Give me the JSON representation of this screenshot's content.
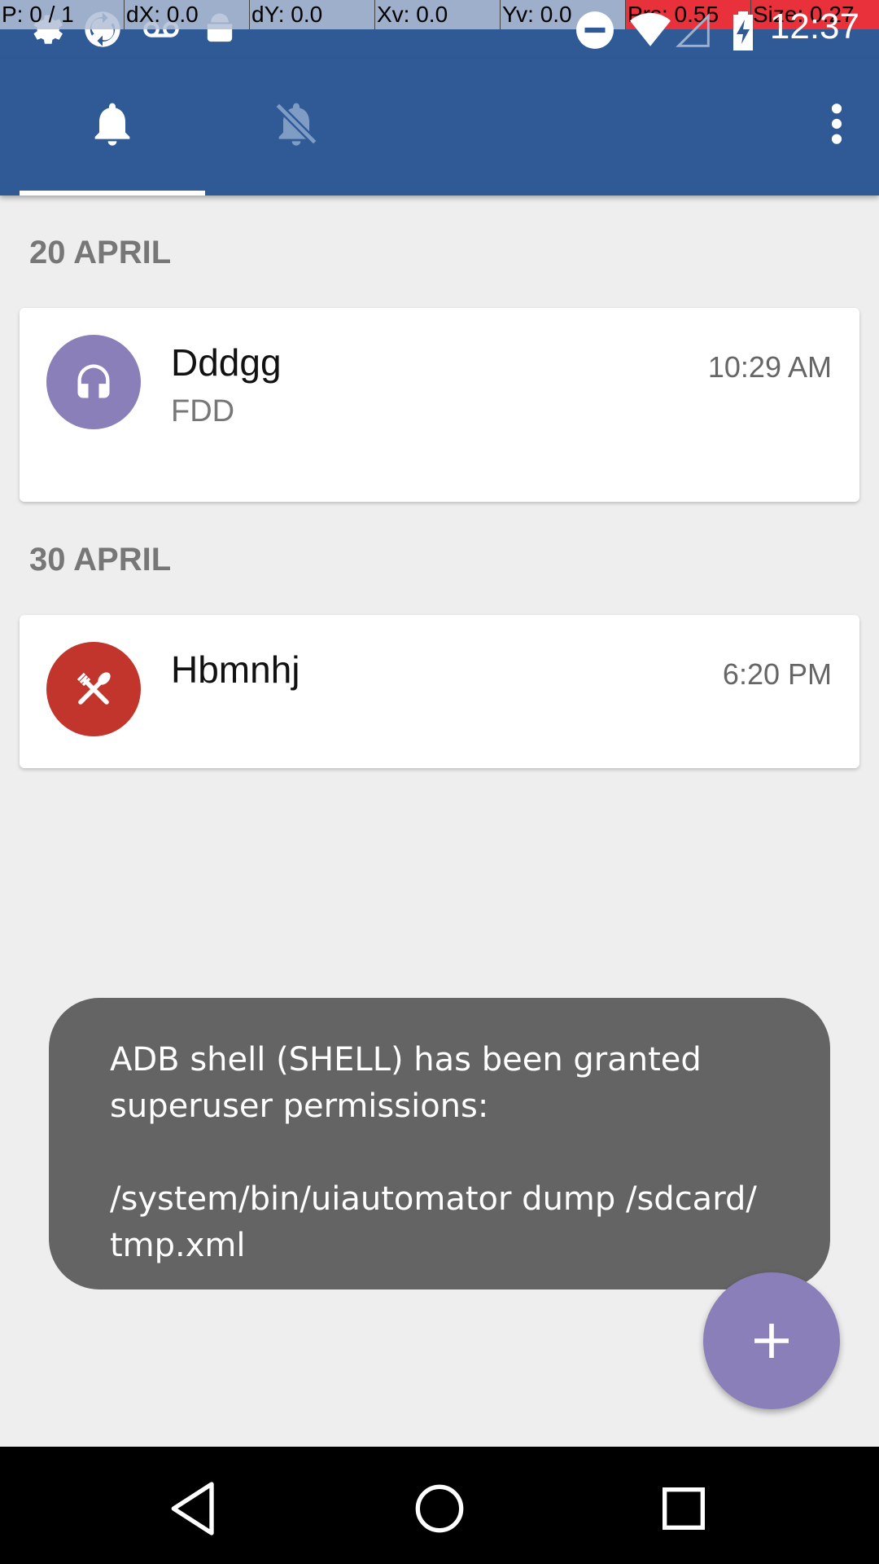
{
  "status_bar": {
    "time": "12:37",
    "icons": [
      "settings-icon",
      "sync-icon",
      "voicemail-icon",
      "android-icon",
      "do-not-disturb-icon",
      "wifi-icon",
      "signal-icon",
      "battery-charging-icon"
    ]
  },
  "debug_overlay": {
    "p": "P: 0 / 1",
    "dx": "dX: 0.0",
    "dy": "dY: 0.0",
    "xv": "Xv: 0.0",
    "yv": "Yv: 0.0",
    "prs": "Prs: 0.55",
    "size": "Size: 0.27"
  },
  "tabs": [
    {
      "icon": "bell-icon",
      "selected": true
    },
    {
      "icon": "bell-off-icon",
      "selected": false
    }
  ],
  "sections": [
    {
      "header": "20 APRIL",
      "items": [
        {
          "title": "Dddgg",
          "subtitle": "FDD",
          "time": "10:29 AM",
          "icon": "headphones-icon",
          "color": "#8a7fb8"
        }
      ]
    },
    {
      "header": "30 APRIL",
      "items": [
        {
          "title": "Hbmnhj",
          "subtitle": "",
          "time": "6:20 PM",
          "icon": "restaurant-icon",
          "color": "#c2352d"
        }
      ]
    }
  ],
  "toast": {
    "text": "ADB shell (SHELL) has been granted\nsuperuser permissions:\n\n/system/bin/uiautomator dump /sdcard/\ntmp.xml"
  },
  "fab": {
    "icon": "plus-icon"
  },
  "nav": [
    "back-icon",
    "home-icon",
    "recents-icon"
  ],
  "colors": {
    "primary": "#2f5a95",
    "accent": "#8a7fb8",
    "background": "#eeeeee"
  }
}
